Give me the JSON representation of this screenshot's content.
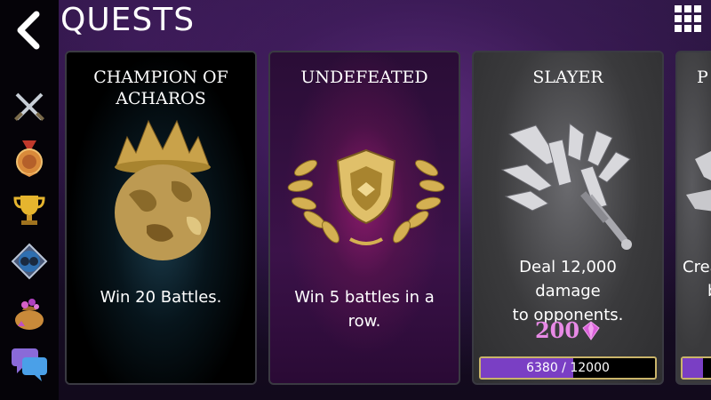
{
  "header": {
    "title": "QUESTS",
    "back_icon": "chevron-left-icon",
    "menu_icon": "grid-menu-icon"
  },
  "sidebar": {
    "items": [
      {
        "icon": "crossed-swords-icon"
      },
      {
        "icon": "medal-icon"
      },
      {
        "icon": "trophy-icon"
      },
      {
        "icon": "versus-emblem-icon"
      },
      {
        "icon": "treasure-bag-icon"
      },
      {
        "icon": "chat-bubbles-icon"
      }
    ]
  },
  "quests": [
    {
      "title_line1": "CHAMPION OF",
      "title_line2": "ACHAROS",
      "description": "Win 20 Battles.",
      "art_icon": "crowned-planet-icon"
    },
    {
      "title_line1": "UNDEFEATED",
      "description_line1": "Win 5 battles in a",
      "description_line2": "row.",
      "art_icon": "laurel-shield-icon"
    },
    {
      "title_line1": "SLAYER",
      "description_line1": "Deal 12,000 damage",
      "description_line2": "to opponents.",
      "art_icon": "shattered-sword-icon",
      "reward": "200",
      "reward_icon": "gem-icon",
      "progress_current": 6380,
      "progress_total": 12000,
      "progress_text_current": "6380",
      "progress_text_sep": " / ",
      "progress_text_total": "12000"
    },
    {
      "title_line1": "P",
      "description_line1": "Crea",
      "description_line2": "b"
    }
  ],
  "colors": {
    "progress_fill": "#7a3fc4",
    "progress_border": "#c9b46a",
    "reward": "#e88ae6"
  }
}
